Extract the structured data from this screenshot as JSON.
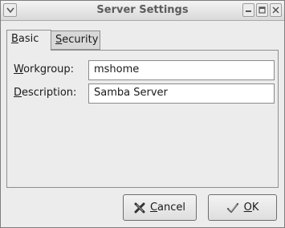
{
  "window": {
    "title": "Server Settings"
  },
  "tabs": [
    {
      "label_accel": "B",
      "label_rest": "asic",
      "selected": true
    },
    {
      "label_accel": "S",
      "label_rest": "ecurity",
      "selected": false
    }
  ],
  "fields": {
    "workgroup": {
      "label_accel": "W",
      "label_rest": "orkgroup:",
      "value": "mshome"
    },
    "description": {
      "label_accel": "D",
      "label_rest": "escription:",
      "value": "Samba Server"
    }
  },
  "buttons": {
    "cancel": {
      "label_accel": "C",
      "label_rest": "ancel",
      "icon": "cancel-x-icon"
    },
    "ok": {
      "label_accel": "O",
      "label_rest": "K",
      "icon": "checkmark-icon"
    }
  },
  "colors": {
    "window_bg": "#ececec",
    "entry_bg": "#ffffff",
    "title_text": "#5c5c5c"
  }
}
